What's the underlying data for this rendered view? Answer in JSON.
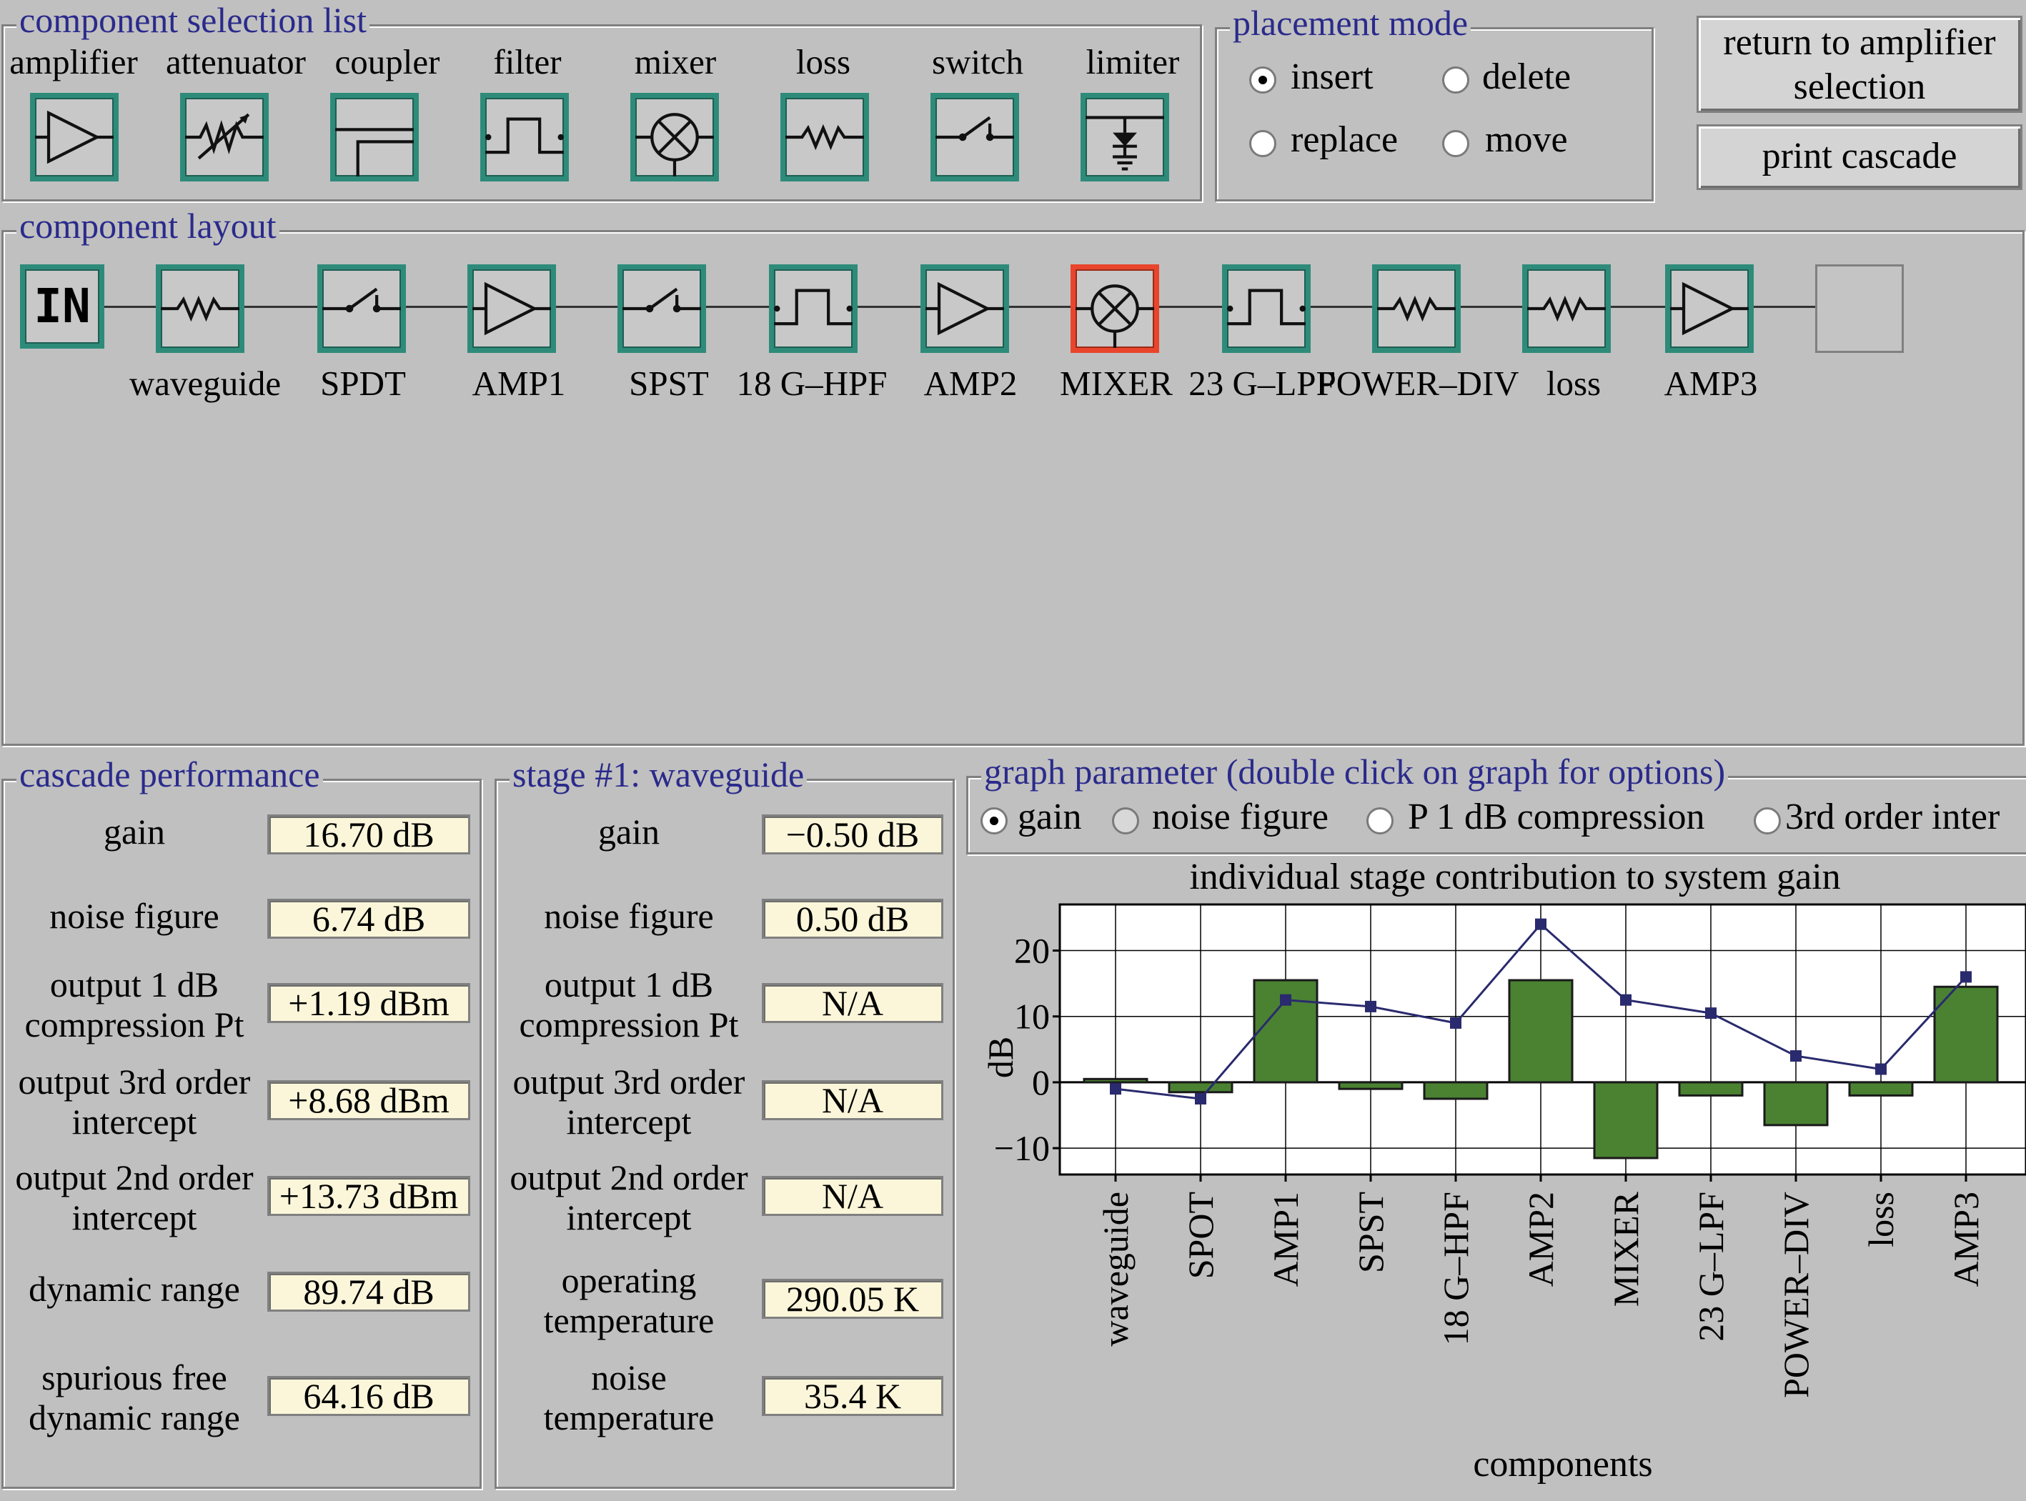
{
  "selection_list": {
    "title": "component selection list",
    "items": [
      {
        "label": "amplifier",
        "icon": "amplifier-icon"
      },
      {
        "label": "attenuator",
        "icon": "attenuator-icon"
      },
      {
        "label": "coupler",
        "icon": "coupler-icon"
      },
      {
        "label": "filter",
        "icon": "filter-icon"
      },
      {
        "label": "mixer",
        "icon": "mixer-icon"
      },
      {
        "label": "loss",
        "icon": "loss-icon"
      },
      {
        "label": "switch",
        "icon": "switch-icon"
      },
      {
        "label": "limiter",
        "icon": "limiter-icon"
      }
    ]
  },
  "placement_mode": {
    "title": "placement mode",
    "options": [
      {
        "label": "insert",
        "selected": true
      },
      {
        "label": "delete",
        "selected": false
      },
      {
        "label": "replace",
        "selected": false
      },
      {
        "label": "move",
        "selected": false
      }
    ]
  },
  "buttons": {
    "return_line1": "return to amplifier",
    "return_line2": "selection",
    "print": "print cascade"
  },
  "layout": {
    "title": "component layout",
    "input_label": "IN",
    "components": [
      {
        "label": "waveguide",
        "icon": "loss-icon"
      },
      {
        "label": "SPDT",
        "icon": "switch-icon"
      },
      {
        "label": "AMP1",
        "icon": "amplifier-icon"
      },
      {
        "label": "SPST",
        "icon": "switch-icon"
      },
      {
        "label": "18 G–HPF",
        "icon": "filter-icon"
      },
      {
        "label": "AMP2",
        "icon": "amplifier-icon"
      },
      {
        "label": "MIXER",
        "icon": "mixer-icon",
        "highlight": true
      },
      {
        "label": "23 G–LPF",
        "icon": "filter-icon"
      },
      {
        "label": "POWER–DIV",
        "icon": "loss-icon"
      },
      {
        "label": "loss",
        "icon": "loss-icon"
      },
      {
        "label": "AMP3",
        "icon": "amplifier-icon"
      }
    ],
    "highlight_color": "#e8452c"
  },
  "cascade": {
    "title": "cascade performance",
    "rows": [
      {
        "label1": "gain",
        "label2": "",
        "value": "16.70 dB"
      },
      {
        "label1": "noise figure",
        "label2": "",
        "value": "6.74 dB"
      },
      {
        "label1": "output 1 dB",
        "label2": "compression Pt",
        "value": "+1.19 dBm"
      },
      {
        "label1": "output 3rd order",
        "label2": "intercept",
        "value": "+8.68 dBm"
      },
      {
        "label1": "output 2nd order",
        "label2": "intercept",
        "value": "+13.73 dBm"
      },
      {
        "label1": "dynamic range",
        "label2": "",
        "value": "89.74 dB"
      },
      {
        "label1": "spurious free",
        "label2": "dynamic range",
        "value": "64.16 dB"
      }
    ]
  },
  "stage": {
    "title": "stage #1: waveguide",
    "rows": [
      {
        "label1": "gain",
        "label2": "",
        "value": "−0.50 dB"
      },
      {
        "label1": "noise figure",
        "label2": "",
        "value": "0.50 dB"
      },
      {
        "label1": "output 1 dB",
        "label2": "compression Pt",
        "value": "N/A"
      },
      {
        "label1": "output 3rd order",
        "label2": "intercept",
        "value": "N/A"
      },
      {
        "label1": "output 2nd order",
        "label2": "intercept",
        "value": "N/A"
      },
      {
        "label1": "operating",
        "label2": "temperature",
        "value": "290.05 K"
      },
      {
        "label1": "noise",
        "label2": "temperature",
        "value": "35.4 K"
      }
    ]
  },
  "graph_param": {
    "title": "graph parameter (double click on graph for options)",
    "options": [
      {
        "label": "gain",
        "selected": true
      },
      {
        "label": "noise figure",
        "selected": false
      },
      {
        "label": "P 1 dB compression",
        "selected": false
      },
      {
        "label": "3rd order inter",
        "selected": false
      }
    ]
  },
  "chart_data": {
    "type": "bar",
    "title": "individual stage contribution to system gain",
    "xlabel": "components",
    "ylabel": "dB",
    "categories": [
      "waveguide",
      "SPOT",
      "AMP1",
      "SPST",
      "18 G–HPF",
      "AMP2",
      "MIXER",
      "23 G–LPF",
      "POWER–DIV",
      "loss",
      "AMP3"
    ],
    "series": [
      {
        "type": "bar",
        "values": [
          0.5,
          -1.5,
          15.5,
          -1.0,
          -2.5,
          15.5,
          -11.5,
          -2.0,
          -6.5,
          -2.0,
          14.5
        ],
        "color": "#4a8232"
      },
      {
        "type": "line",
        "values": [
          -1.0,
          -2.5,
          12.5,
          11.5,
          9.0,
          24.0,
          12.5,
          10.5,
          4.0,
          2.0,
          16.0
        ],
        "color": "#2a2a6e"
      }
    ],
    "yticks": [
      -10,
      0,
      10,
      20
    ],
    "ylim": [
      -14,
      27
    ],
    "grid": true
  }
}
